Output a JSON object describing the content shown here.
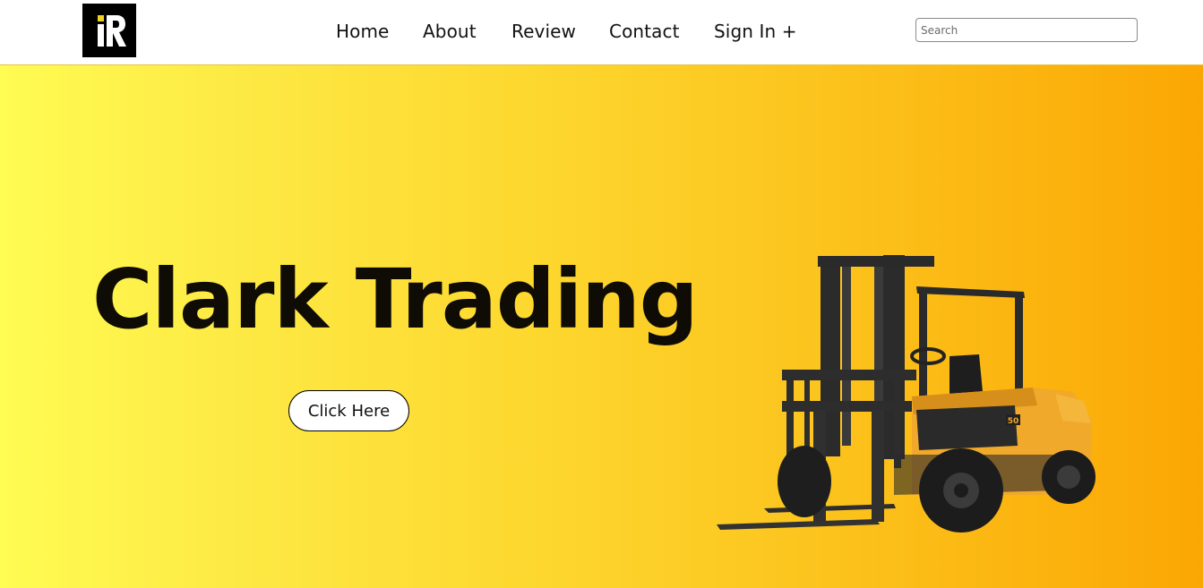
{
  "header": {
    "logo_text": "iR",
    "nav": [
      {
        "label": "Home"
      },
      {
        "label": "About"
      },
      {
        "label": "Review"
      },
      {
        "label": "Contact"
      },
      {
        "label": "Sign In +"
      }
    ],
    "search": {
      "placeholder": "Search",
      "value": ""
    }
  },
  "hero": {
    "title": "Clark Trading",
    "button_label": "Click Here",
    "gradient_start": "#fffc52",
    "gradient_end": "#fba703",
    "image_icon": "forklift-image",
    "forklift_badge": "50"
  },
  "colors": {
    "forklift_body": "#f0a92a",
    "forklift_frame": "#2a2a2a",
    "logo_bg": "#000000",
    "logo_accent": "#f2d21b"
  }
}
